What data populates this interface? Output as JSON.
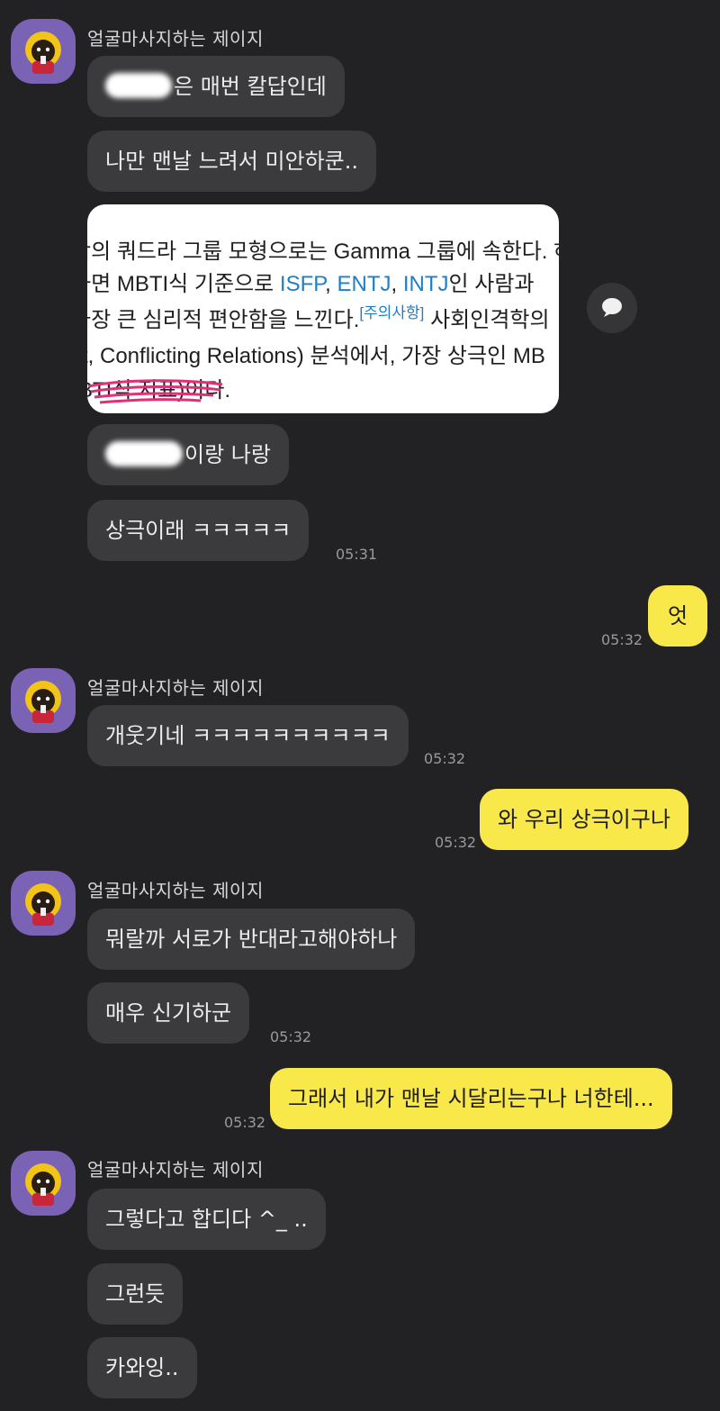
{
  "sender_name": "얼굴마사지하는 제이지",
  "messages": {
    "m1_text": "은 매번 칼답인데",
    "m2_text": "나만 맨날 느려서 미안하쿤..",
    "image_lines": {
      "l1": "학의 쿼드라 그룹 모형으로는 Gamma 그룹에 속한다. 하",
      "l2_a": "하면 MBTI식 기준으로 ",
      "l2_isfp": "ISFP",
      "l2_sep1": ", ",
      "l2_entj": "ENTJ",
      "l2_sep2": ", ",
      "l2_intj": "INTJ",
      "l2_b": "인 사람과 ",
      "l3_a": " 가장 큰 심리적 편안함을 느낀다.",
      "l3_note": "[주의사항]",
      "l3_b": " 사회인격학의",
      "l4": "ct, Conflicting Relations) 분석에서, 가장 상극인 MB",
      "l5": "BTI식 지표)이다."
    },
    "m3_text": "이랑 나랑",
    "m4_text": "상극이래 ㅋㅋㅋㅋㅋ",
    "m4_time": "05:31",
    "m5_text": "엇",
    "m5_time": "05:32",
    "m6_text": "개웃기네 ㅋㅋㅋㅋㅋㅋㅋㅋㅋㅋ",
    "m6_time": "05:32",
    "m7_text": "와 우리 상극이구나",
    "m7_time": "05:32",
    "m8_text": "뭐랄까 서로가 반대라고해야하나",
    "m9_text": "매우 신기하군",
    "m9_time": "05:32",
    "m10_text": "그래서 내가 맨날 시달리는구나 너한테...",
    "m10_time": "05:32",
    "m11_text": "그렇다고 합디다 ^_ ..",
    "m12_text": "그런듯",
    "m13_text": "카와잉.."
  },
  "colors": {
    "background": "#222224",
    "incoming_bubble": "#3b3b3d",
    "outgoing_bubble": "#f9e84a",
    "avatar_bg": "#7a62b4",
    "link": "#1e7fc6",
    "highlight_scribble": "#e0307a"
  },
  "icons": {
    "share": "speech-bubble-icon",
    "avatar": "character-avatar"
  }
}
